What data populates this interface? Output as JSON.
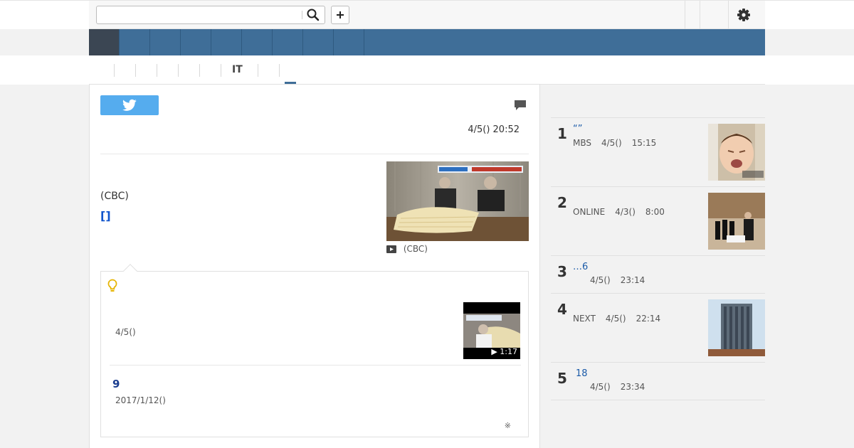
{
  "search": {
    "placeholder": "",
    "value": ""
  },
  "subnav": {
    "active_label": "IT"
  },
  "article": {
    "timestamp": "4/5() 20:52",
    "source": "(CBC)",
    "link_text": "[]",
    "photo_caption": "(CBC)"
  },
  "related": {
    "item1": {
      "date": "4/5()",
      "duration": "▶ 1:17"
    },
    "item2": {
      "title": "9",
      "date": "2017/1/12()"
    },
    "note": "※"
  },
  "ranking": [
    {
      "rank": "1",
      "title": "“”",
      "source": "MBS",
      "date": "4/5()",
      "time": "15:15"
    },
    {
      "rank": "2",
      "title": "",
      "source": "ONLINE",
      "date": "4/3()",
      "time": "8:00"
    },
    {
      "rank": "3",
      "title": "…6",
      "source": "",
      "date": "4/5()",
      "time": "23:14"
    },
    {
      "rank": "4",
      "title": "",
      "source": "NEXT",
      "date": "4/5()",
      "time": "22:14"
    },
    {
      "rank": "5",
      "title": "18",
      "source": "",
      "date": "4/5()",
      "time": "23:34"
    }
  ],
  "colors": {
    "nav": "#3f6e98",
    "nav_active": "#3b4653",
    "link": "#1155cc",
    "twitter": "#55acee"
  },
  "icons": [
    "search-icon",
    "plus-icon",
    "gear-icon",
    "twitter-icon",
    "comment-icon",
    "video-icon",
    "bulb-icon"
  ]
}
